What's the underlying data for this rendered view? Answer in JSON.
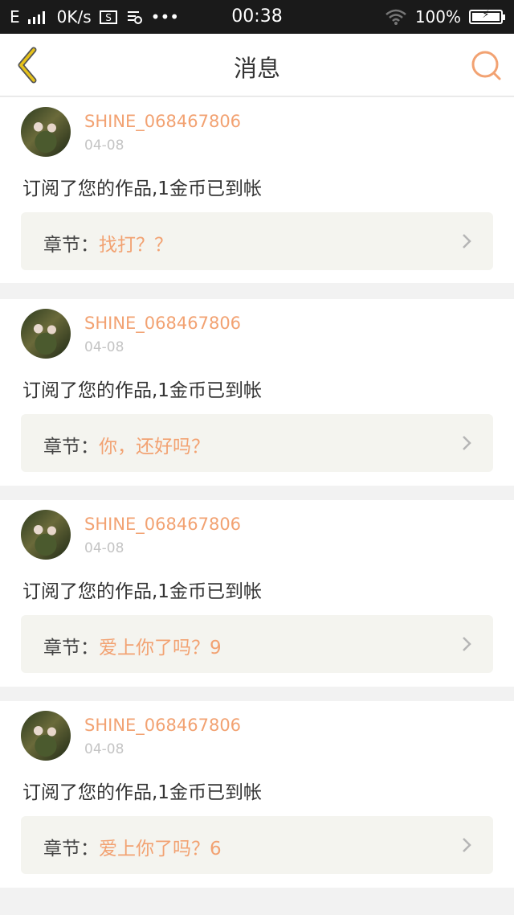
{
  "statusbar": {
    "network": "E",
    "speed": "0K/s",
    "time": "00:38",
    "battery": "100%",
    "battery_level": 1.0
  },
  "navbar": {
    "title": "消息"
  },
  "messages": [
    {
      "username": "SHINE_068467806",
      "date": "04-08",
      "text": "订阅了您的作品,1金币已到帐",
      "chapter_label": "章节：",
      "chapter_title": "找打？？"
    },
    {
      "username": "SHINE_068467806",
      "date": "04-08",
      "text": "订阅了您的作品,1金币已到帐",
      "chapter_label": "章节：",
      "chapter_title": "你，还好吗？"
    },
    {
      "username": "SHINE_068467806",
      "date": "04-08",
      "text": "订阅了您的作品,1金币已到帐",
      "chapter_label": "章节：",
      "chapter_title": "爱上你了吗？9"
    },
    {
      "username": "SHINE_068467806",
      "date": "04-08",
      "text": "订阅了您的作品,1金币已到帐",
      "chapter_label": "章节：",
      "chapter_title": "爱上你了吗？6"
    }
  ],
  "colors": {
    "accent": "#f2a272",
    "back_icon": "#e6c21a"
  }
}
